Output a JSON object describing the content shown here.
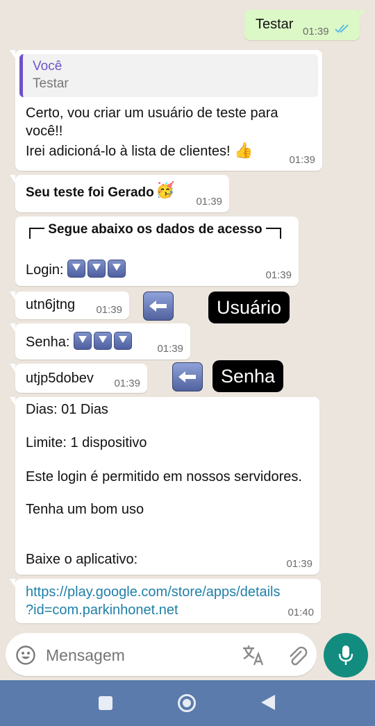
{
  "messages": {
    "outgoing_1": {
      "text": "Testar",
      "time": "01:39"
    },
    "reply": {
      "quote_author": "Você",
      "quote_text": "Testar",
      "line1": "Certo, vou criar um usuário de teste para",
      "line2": "você!!",
      "line3": "Irei adicioná-lo à lista de clientes!",
      "time": "01:39"
    },
    "generated": {
      "text": "Seu teste foi Gerado",
      "time": "01:39"
    },
    "access_header": {
      "text": "Segue abaixo os dados de acesso",
      "login_label": "Login:",
      "time": "01:39"
    },
    "username": {
      "text": "utn6jtng",
      "time": "01:39"
    },
    "password_label": {
      "text": "Senha:",
      "time": "01:39"
    },
    "password": {
      "text": "utjp5dobev",
      "time": "01:39"
    },
    "details": {
      "line1": "Dias: 01 Dias",
      "line2": "Limite: 1 dispositivo",
      "line3": "Este login é permitido em nossos servidores.",
      "line4": "Tenha um bom uso",
      "line5": "Baixe o aplicativo:",
      "time": "01:39"
    },
    "link": {
      "line1": "https://play.google.com/store/apps/details",
      "line2": "?id=com.parkinhonet.net",
      "time": "01:40"
    }
  },
  "annotations": {
    "usuario": "Usuário",
    "senha": "Senha"
  },
  "composer": {
    "placeholder": "Mensagem"
  },
  "colors": {
    "accent": "#128c7e",
    "outgoing_bubble": "#dcf8c6",
    "navbar": "#5a7bab",
    "link": "#1f7fa8"
  }
}
